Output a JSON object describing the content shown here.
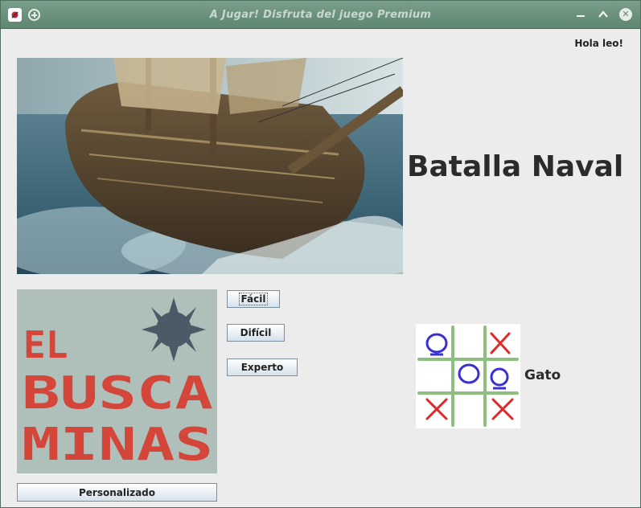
{
  "window": {
    "title": "A Jugar! Disfruta del juego Premium"
  },
  "header": {
    "greeting": "Hola  leo!"
  },
  "games": {
    "battleship": {
      "title": "Batalla Naval"
    },
    "minesweeper": {
      "logo_text_line1": "EL",
      "logo_text_line2": "BUSCA",
      "logo_text_line3": "MINAS",
      "buttons": {
        "easy": "Fácil",
        "hard": "Difícil",
        "expert": "Experto",
        "custom": "Personalizado"
      }
    },
    "tictactoe": {
      "label": "Gato"
    }
  },
  "colors": {
    "titlebar": "#5d8670",
    "background": "#ececec",
    "x_mark": "#e02a2a",
    "o_mark": "#3a2fd1",
    "grid": "#8fbf80",
    "minas_text": "#d4453a"
  },
  "icons": [
    "app-icon",
    "add-icon",
    "minimize-icon",
    "maximize-icon",
    "close-icon",
    "naval-mine-icon"
  ]
}
